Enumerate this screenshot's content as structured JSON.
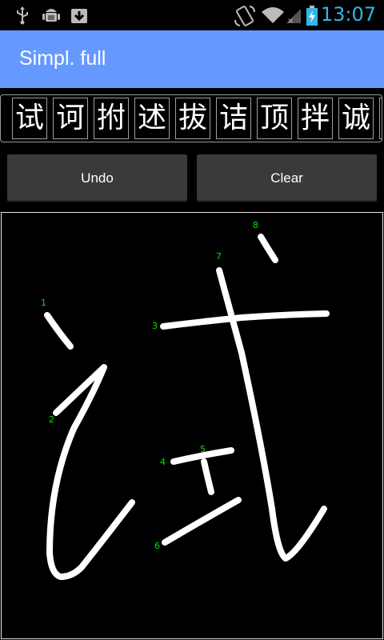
{
  "status_bar": {
    "time": "13:07",
    "icons": [
      "usb-icon",
      "android-debug-icon",
      "download-icon",
      "rotation-lock-icon",
      "wifi-icon",
      "signal-icon",
      "battery-charging-icon"
    ],
    "accent_color": "#33b5e5"
  },
  "action_bar": {
    "title": "Simpl. full",
    "color": "#6699ff"
  },
  "candidates": [
    "试",
    "诃",
    "拊",
    "述",
    "拔",
    "诘",
    "顶",
    "拌",
    "诚"
  ],
  "buttons": {
    "undo": "Undo",
    "clear": "Clear"
  },
  "canvas": {
    "stroke_color": "#ffffff",
    "label_color": "#00e600",
    "stroke_numbers": [
      "1",
      "2",
      "3",
      "4",
      "5",
      "6",
      "7",
      "8"
    ]
  }
}
